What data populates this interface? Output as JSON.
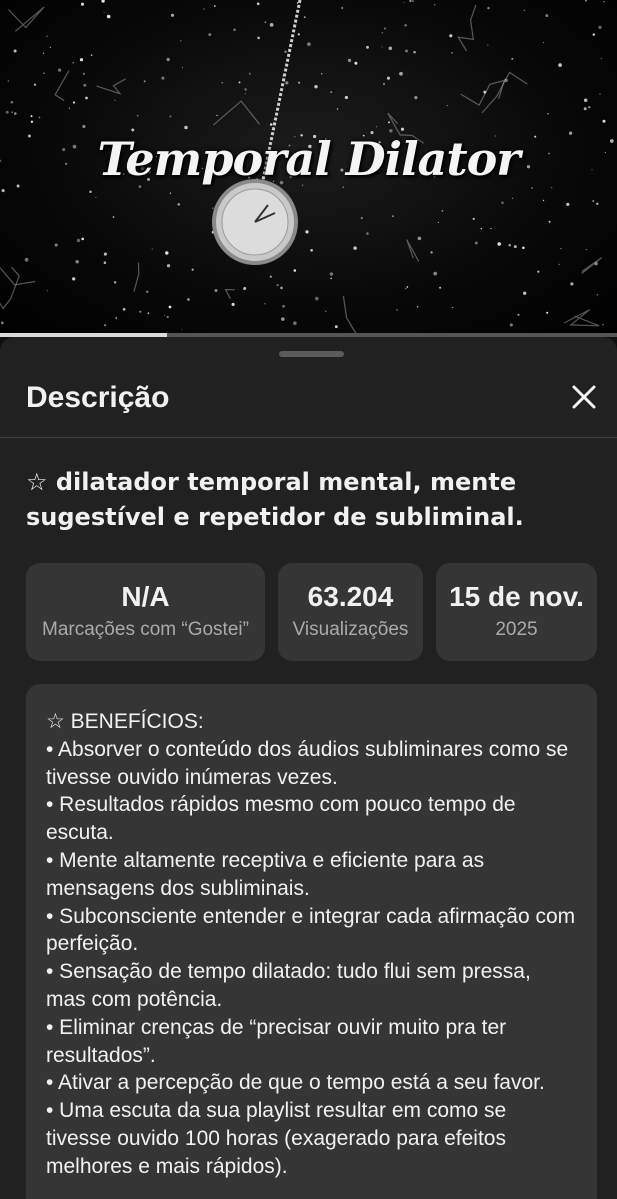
{
  "video": {
    "overlay_title": "Temporal Dilator",
    "progress": 0.27
  },
  "sheet": {
    "title": "Descrição",
    "close_icon": "close-icon",
    "video_title": "☆ dilatador temporal mental, mente sugestível e repetidor de subliminal.",
    "stats": [
      {
        "value": "N/A",
        "label": "Marcações com “Gostei”"
      },
      {
        "value": "63.204",
        "label": "Visualizações"
      },
      {
        "value": "15 de nov.",
        "label": "2025"
      }
    ],
    "description": "☆ BENEFÍCIOS:\n• Absorver o conteúdo dos áudios subliminares como se tivesse ouvido inúmeras vezes.\n• Resultados rápidos mesmo com pouco tempo de escuta.\n• Mente altamente receptiva e eficiente para as mensagens dos subliminais.\n• Subconsciente entender e integrar cada afirmação com perfeição.\n• Sensação de tempo dilatado: tudo flui sem pressa, mas com potência.\n• Eliminar crenças de “precisar ouvir muito pra ter resultados”.\n• Ativar a percepção de que o tempo está a seu favor.\n• Uma escuta da sua playlist resultar em como se tivesse ouvido 100 horas (exagerado para efeitos melhores e mais rápidos)."
  },
  "colors": {
    "sheet_background": "#212121",
    "card_background": "#353535",
    "secondary_text": "#aaaaaa"
  }
}
